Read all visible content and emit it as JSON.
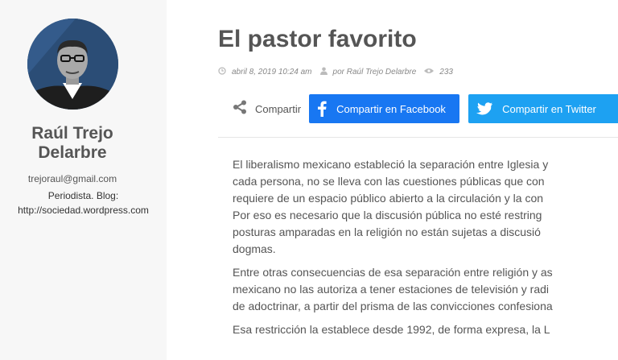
{
  "author": {
    "name_line1": "Raúl Trejo",
    "name_line2": "Delarbre",
    "email": "trejoraul@gmail.com",
    "bio_line1": "Periodista. Blog:",
    "bio_line2": "http://sociedad.wordpress.com"
  },
  "post": {
    "title": "El pastor favorito",
    "date": "abril 8, 2019 10:24 am",
    "author_meta": "por Raúl Trejo Delarbre",
    "views": "233"
  },
  "share": {
    "label": "Compartir",
    "facebook": "Compartir en Facebook",
    "twitter": "Compartir en Twitter"
  },
  "paragraphs": [
    [
      "El liberalismo mexicano estableció la separación entre Iglesia y",
      "cada persona, no se lleva con las cuestiones públicas que con",
      "requiere de un espacio público abierto a la circulación y la con",
      "Por eso es necesario que la discusión pública no esté restring",
      "posturas amparadas en la religión no están sujetas a discusió",
      "dogmas."
    ],
    [
      "Entre otras consecuencias de esa separación entre religión y as",
      "mexicano no las autoriza a tener estaciones de televisión y radi",
      "de adoctrinar, a partir del prisma de las convicciones confesiona"
    ],
    [
      "Esa restricción la establece desde 1992, de forma expresa, la L"
    ]
  ],
  "colors": {
    "facebook": "#1877f2",
    "twitter": "#1da1f2"
  }
}
